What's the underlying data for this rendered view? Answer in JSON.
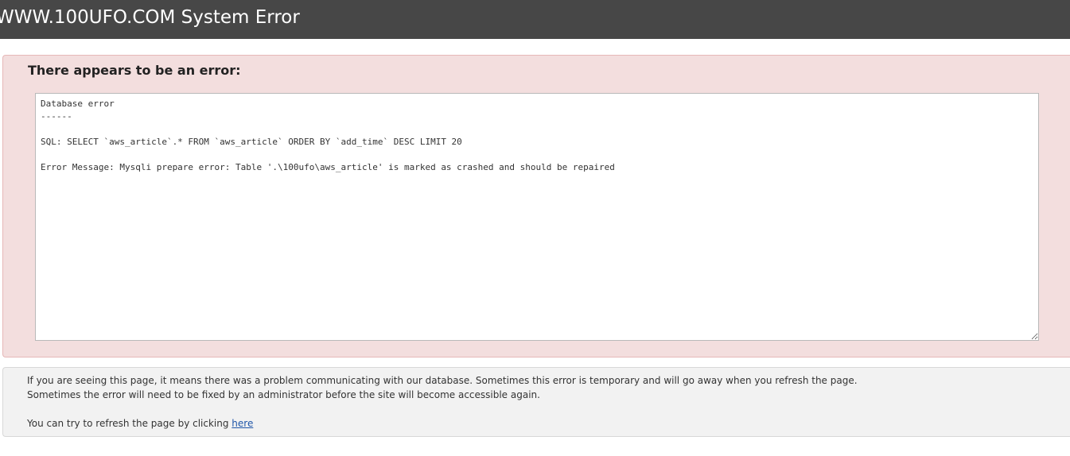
{
  "header": {
    "title": "WWW.100UFO.COM System Error"
  },
  "error_panel": {
    "heading": "There appears to be an error:",
    "message_lines": [
      "Database error",
      "------",
      "",
      "SQL: SELECT `aws_article`.* FROM `aws_article` ORDER BY `add_time` DESC LIMIT 20",
      "",
      "Error Message: Mysqli prepare error: Table '.\\100ufo\\aws_article' is marked as crashed and should be repaired"
    ]
  },
  "info_panel": {
    "line1": "If you are seeing this page, it means there was a problem communicating with our database. Sometimes this error is temporary and will go away when you refresh the page.",
    "line2": "Sometimes the error will need to be fixed by an administrator before the site will become accessible again.",
    "refresh_prefix": "You can try to refresh the page by clicking ",
    "refresh_link": "here"
  },
  "colors": {
    "header_bg": "#474747",
    "error_bg": "#f3dede",
    "info_bg": "#f2f2f2",
    "link": "#1f56a8"
  }
}
